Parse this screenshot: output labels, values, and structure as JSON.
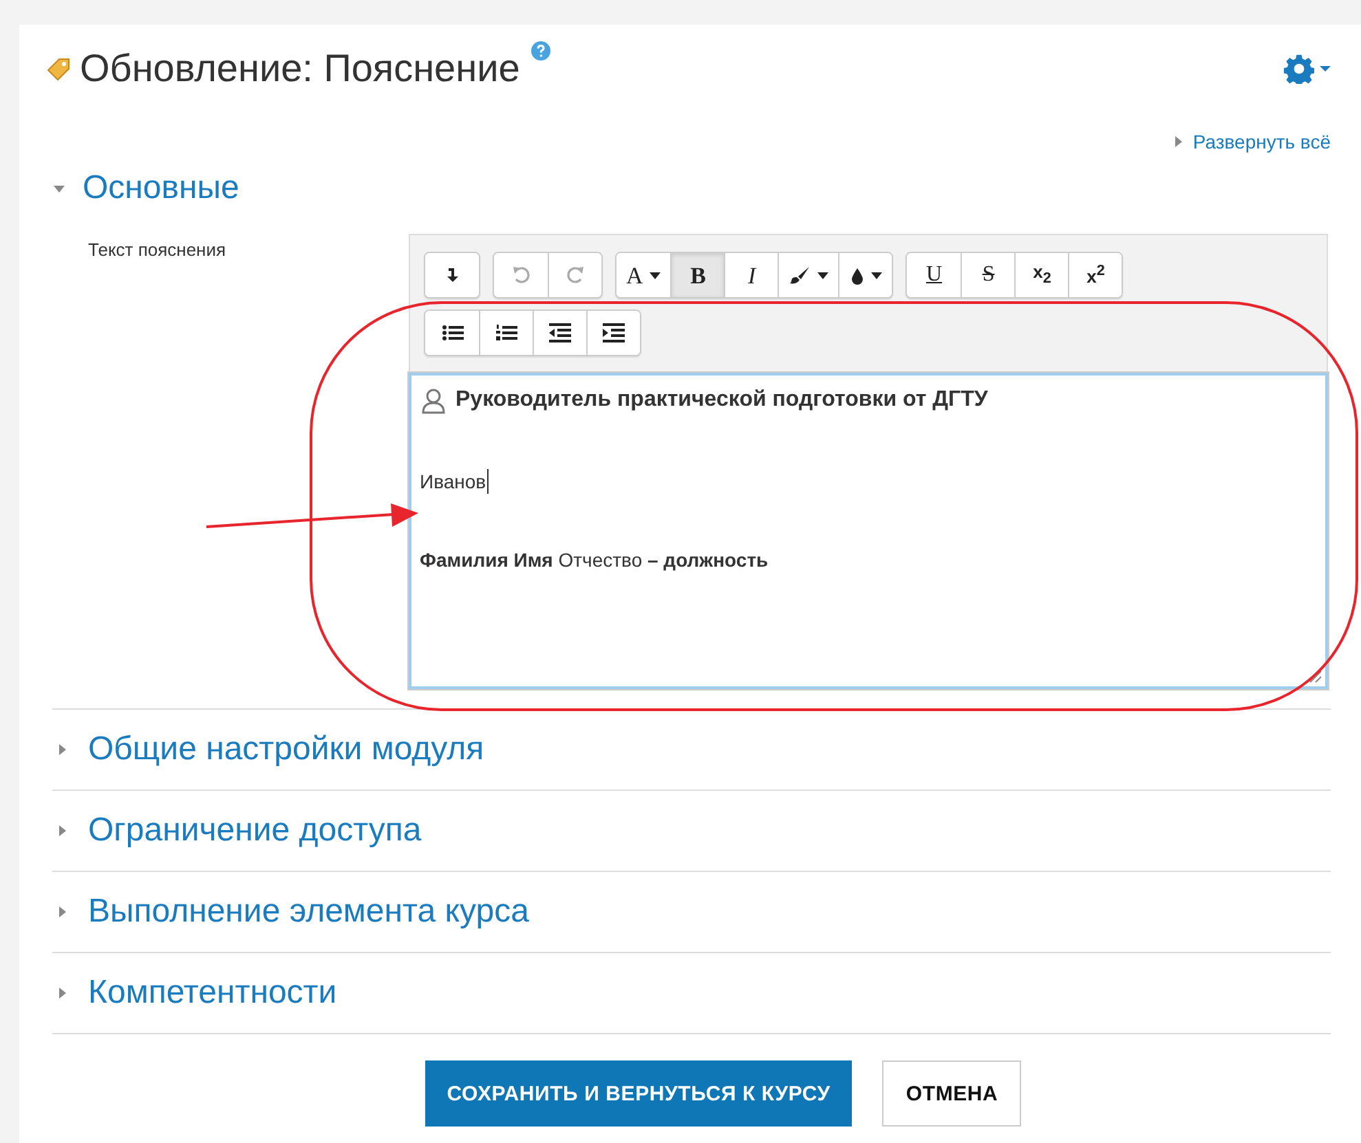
{
  "header": {
    "title": "Обновление: Пояснение",
    "help": true,
    "menu": true
  },
  "expand_all": "Развернуть всё",
  "main_section": {
    "title": "Основные",
    "expanded": true,
    "field_label": "Текст пояснения",
    "toolbar": [
      [
        [
          {
            "kind": "icon",
            "disabled": false,
            "pressed": false
          }
        ],
        [
          {
            "kind": "icon",
            "disabled": true,
            "pressed": false
          },
          {
            "kind": "icon",
            "disabled": true,
            "pressed": false
          }
        ],
        [
          {
            "kind": "text",
            "label": "A",
            "dropdown": true,
            "disabled": false,
            "pressed": false
          },
          {
            "kind": "text",
            "label": "B",
            "dropdown": false,
            "disabled": false,
            "pressed": true
          },
          {
            "kind": "text",
            "label": "I",
            "dropdown": false,
            "disabled": false,
            "pressed": false
          },
          {
            "kind": "icon",
            "dropdown": true,
            "disabled": false,
            "pressed": false
          },
          {
            "kind": "icon",
            "dropdown": true,
            "disabled": false,
            "pressed": false
          }
        ],
        [
          {
            "kind": "text",
            "label": "U",
            "dropdown": false,
            "disabled": false,
            "pressed": false
          },
          {
            "kind": "text",
            "label": "S",
            "dropdown": false,
            "disabled": false,
            "pressed": false
          },
          {
            "kind": "text",
            "label": "x$_{2}$",
            "dropdown": false,
            "disabled": false,
            "pressed": false
          },
          {
            "kind": "text",
            "label": "x$^{2}$",
            "dropdown": false,
            "disabled": false,
            "pressed": false
          }
        ]
      ],
      [
        [
          {
            "kind": "icon",
            "disabled": false,
            "pressed": false
          },
          {
            "kind": "icon",
            "disabled": false,
            "pressed": false
          },
          {
            "kind": "icon",
            "disabled": false,
            "pressed": false
          },
          {
            "kind": "icon",
            "disabled": false,
            "pressed": false
          }
        ]
      ]
    ],
    "content": [
      {
        "kind": "heading",
        "text": "Руководитель практической подготовки от ДГТУ"
      },
      {
        "kind": "plain",
        "text": "Иванов",
        "caret": true
      },
      {
        "kind": "plain",
        "text": "**Фамилия Имя** Отчество **– должность**",
        "caret": false
      }
    ]
  },
  "sections": [
    {
      "title": "Общие настройки модуля",
      "expanded": false
    },
    {
      "title": "Ограничение доступа",
      "expanded": false
    },
    {
      "title": "Выполнение элемента курса",
      "expanded": false
    },
    {
      "title": "Компетентности",
      "expanded": false
    }
  ],
  "buttons": [
    {
      "label": "СОХРАНИТЬ И ВЕРНУТЬСЯ К КУРСУ",
      "kind": "primary"
    },
    {
      "label": "ОТМЕНА",
      "kind": "secondary"
    }
  ]
}
